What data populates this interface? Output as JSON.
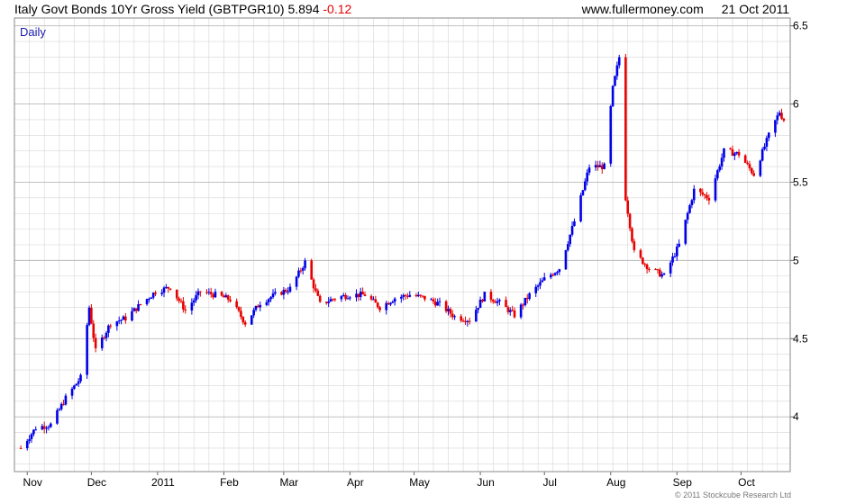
{
  "header": {
    "title": "Italy Govt Bonds 10Yr Gross Yield (GBTPGR10)",
    "last": "5.894",
    "change": "-0.12",
    "site": "www.fullermoney.com",
    "date": "21 Oct 2011"
  },
  "period_label": "Daily",
  "copyright": "© 2011 Stockcube Research Ltd",
  "colors": {
    "up": "#0000e6",
    "down": "#e60000",
    "grid": "#d6d6d6",
    "frame": "#888888"
  },
  "chart_data": {
    "type": "candlestick",
    "title": "Italy Govt Bonds 10Yr Gross Yield (GBTPGR10)",
    "ylim": [
      3.65,
      6.55
    ],
    "y_ticks": [
      "4",
      "4.5",
      "5",
      "5.5",
      "6",
      "6.5"
    ],
    "x_ticks": [
      "Nov",
      "Dec",
      "2011",
      "Feb",
      "Mar",
      "Apr",
      "May",
      "Jun",
      "Jul",
      "Aug",
      "Sep",
      "Oct"
    ],
    "legend": "none",
    "grid": true,
    "series": [
      {
        "values": [
          [
            "2010-10-29",
            3.8
          ],
          [
            "2010-11-05",
            3.93
          ],
          [
            "2010-11-12",
            3.95
          ],
          [
            "2010-11-19",
            4.12
          ],
          [
            "2010-11-26",
            4.25
          ],
          [
            "2010-11-30",
            4.7
          ],
          [
            "2010-12-03",
            4.42
          ],
          [
            "2010-12-10",
            4.6
          ],
          [
            "2010-12-17",
            4.63
          ],
          [
            "2010-12-24",
            4.72
          ],
          [
            "2010-12-31",
            4.8
          ],
          [
            "2011-01-07",
            4.83
          ],
          [
            "2011-01-14",
            4.68
          ],
          [
            "2011-01-21",
            4.8
          ],
          [
            "2011-01-28",
            4.78
          ],
          [
            "2011-02-04",
            4.75
          ],
          [
            "2011-02-11",
            4.6
          ],
          [
            "2011-02-18",
            4.73
          ],
          [
            "2011-02-25",
            4.78
          ],
          [
            "2011-03-04",
            4.82
          ],
          [
            "2011-03-11",
            4.99
          ],
          [
            "2011-03-18",
            4.72
          ],
          [
            "2011-03-25",
            4.76
          ],
          [
            "2011-04-01",
            4.78
          ],
          [
            "2011-04-08",
            4.78
          ],
          [
            "2011-04-15",
            4.7
          ],
          [
            "2011-04-22",
            4.76
          ],
          [
            "2011-04-29",
            4.78
          ],
          [
            "2011-05-06",
            4.76
          ],
          [
            "2011-05-13",
            4.72
          ],
          [
            "2011-05-20",
            4.64
          ],
          [
            "2011-05-27",
            4.62
          ],
          [
            "2011-06-03",
            4.78
          ],
          [
            "2011-06-10",
            4.73
          ],
          [
            "2011-06-17",
            4.65
          ],
          [
            "2011-06-24",
            4.78
          ],
          [
            "2011-07-01",
            4.88
          ],
          [
            "2011-07-08",
            4.95
          ],
          [
            "2011-07-15",
            5.25
          ],
          [
            "2011-07-22",
            5.6
          ],
          [
            "2011-07-29",
            5.6
          ],
          [
            "2011-08-02",
            6.1
          ],
          [
            "2011-08-05",
            6.3
          ],
          [
            "2011-08-08",
            5.4
          ],
          [
            "2011-08-12",
            5.05
          ],
          [
            "2011-08-19",
            4.95
          ],
          [
            "2011-08-26",
            4.9
          ],
          [
            "2011-09-02",
            5.1
          ],
          [
            "2011-09-09",
            5.45
          ],
          [
            "2011-09-16",
            5.4
          ],
          [
            "2011-09-23",
            5.7
          ],
          [
            "2011-09-30",
            5.68
          ],
          [
            "2011-10-07",
            5.55
          ],
          [
            "2011-10-14",
            5.8
          ],
          [
            "2011-10-19",
            5.95
          ],
          [
            "2011-10-21",
            5.894
          ]
        ]
      }
    ]
  }
}
